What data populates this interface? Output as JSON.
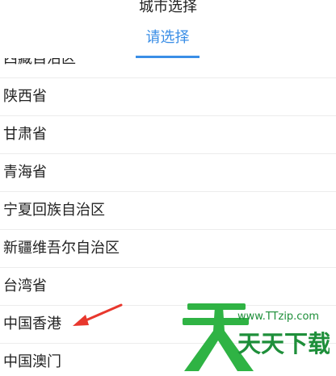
{
  "header": {
    "title": "城市选择",
    "tab_label": "请选择",
    "accent_color": "#3a8ee6"
  },
  "list": {
    "items": [
      {
        "label": "西藏自治区"
      },
      {
        "label": "陕西省"
      },
      {
        "label": "甘肃省"
      },
      {
        "label": "青海省"
      },
      {
        "label": "宁夏回族自治区"
      },
      {
        "label": "新疆维吾尔自治区"
      },
      {
        "label": "台湾省"
      },
      {
        "label": "中国香港"
      },
      {
        "label": "中国澳门"
      }
    ]
  },
  "annotation": {
    "arrow_color": "#e8372d",
    "points_to": "中国香港"
  },
  "watermark": {
    "logo_char": "天",
    "url": "www.TTzip.com",
    "brand": "天天下载",
    "logo_color": "#2fb344",
    "brand_color": "#1e8f3a"
  }
}
